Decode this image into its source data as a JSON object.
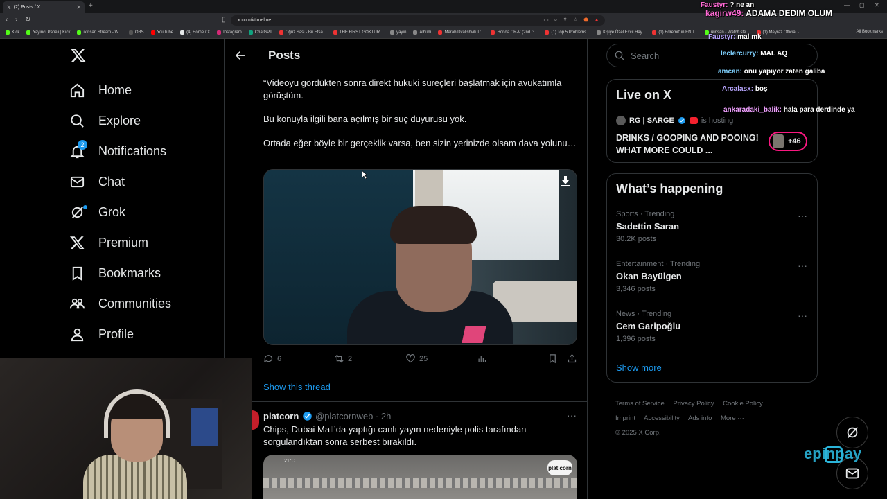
{
  "browser": {
    "tab_title": "(2) Posts / X",
    "url": "x.com/i/timeline",
    "new_tab": "+",
    "bookmarks": [
      "Kick",
      "Yayıncı Paneli | Kick",
      "ikinsan Stream - W...",
      "OBS",
      "YouTube",
      "(4) Home / X",
      "Instagram",
      "ChatGPT",
      "Oğuz Sasi - Bir Efsa...",
      "THE FIRST GOKTUR...",
      "yayın",
      "Albüm",
      "Merab Dvalishvili Tr...",
      "Honda CR-V (2nd G...",
      "(1) Top 5 Problems...",
      "Kişiye Özel Excil Hay...",
      "(1) Edremit' in EN T...",
      "ikinsan - Watch ste...",
      "(1) Meyraz Official -..."
    ],
    "all_bookmarks": "All Bookmarks"
  },
  "sidebar": {
    "items": [
      {
        "label": "Home",
        "icon": "home-icon"
      },
      {
        "label": "Explore",
        "icon": "search-icon"
      },
      {
        "label": "Notifications",
        "icon": "bell-icon",
        "badge": "2"
      },
      {
        "label": "Chat",
        "icon": "mail-icon"
      },
      {
        "label": "Grok",
        "icon": "grok-icon"
      },
      {
        "label": "Premium",
        "icon": "x-icon"
      },
      {
        "label": "Bookmarks",
        "icon": "bookmark-icon"
      },
      {
        "label": "Communities",
        "icon": "people-icon"
      },
      {
        "label": "Profile",
        "icon": "person-icon"
      }
    ]
  },
  "header": {
    "title": "Posts"
  },
  "tweet1": {
    "para1": "“Videoyu gördükten sonra direkt hukuki süreçleri başlatmak için avukatımla görüştüm.",
    "para2": "Bu konuyla ilgili bana açılmış bir suç duyurusu yok.",
    "para3": "Ortada eğer böyle bir gerçeklik varsa, ben sizin yerinizde olsam dava yolunu…",
    "replies": "6",
    "reposts": "2",
    "likes": "25",
    "show_thread": "Show this thread"
  },
  "tweet2": {
    "name": "platcorn",
    "handle": "@platcornweb · 2h",
    "text": "Chips, Dubai Mall’da yaptığı canlı yayın nedeniyle polis tarafından sorgulandıktan sonra serbest bırakıldı.",
    "media_logo": "plat corn",
    "media_weather": "21°C"
  },
  "search": {
    "placeholder": "Search"
  },
  "live": {
    "title": "Live on X",
    "host": "RG | SARGE",
    "host_suffix": "is hosting",
    "stream_title": "DRINKS / GOOPING AND POOING! WHAT MORE COULD ...",
    "count": "+46"
  },
  "trends": {
    "title": "What’s happening",
    "items": [
      {
        "meta": "Sports · Trending",
        "name": "Sadettin Saran",
        "count": "30.2K posts"
      },
      {
        "meta": "Entertainment · Trending",
        "name": "Okan Bayülgen",
        "count": "3,346 posts"
      },
      {
        "meta": "News · Trending",
        "name": "Cem Garipoğlu",
        "count": "1,396 posts"
      }
    ],
    "show_more": "Show more"
  },
  "footer": {
    "links": [
      "Terms of Service",
      "Privacy Policy",
      "Cookie Policy",
      "Imprint",
      "Accessibility",
      "Ads info",
      "More ···"
    ],
    "copyright": "© 2025 X Corp."
  },
  "chat_overlay": [
    {
      "user": "Faustyr:",
      "msg": "? ne an"
    },
    {
      "user": "kagirw49:",
      "msg": "ADAMA DEDIM OLUM"
    },
    {
      "user": "Faustyr:",
      "msg": "mal mk"
    },
    {
      "user": "leclercurry:",
      "msg": "MAL AQ"
    },
    {
      "user": "amcan:",
      "msg": "onu yapıyor zaten galiba"
    },
    {
      "user": "Arcalasx:",
      "msg": "boş"
    },
    {
      "user": "ankaradaki_balik:",
      "msg": "hala para derdinde ya"
    }
  ],
  "watermark": "epinpay",
  "colors": {
    "accent": "#1d9bf0",
    "bg": "#000000",
    "border": "#2f3336",
    "muted": "#71767b",
    "live_ring": "#f91880"
  }
}
